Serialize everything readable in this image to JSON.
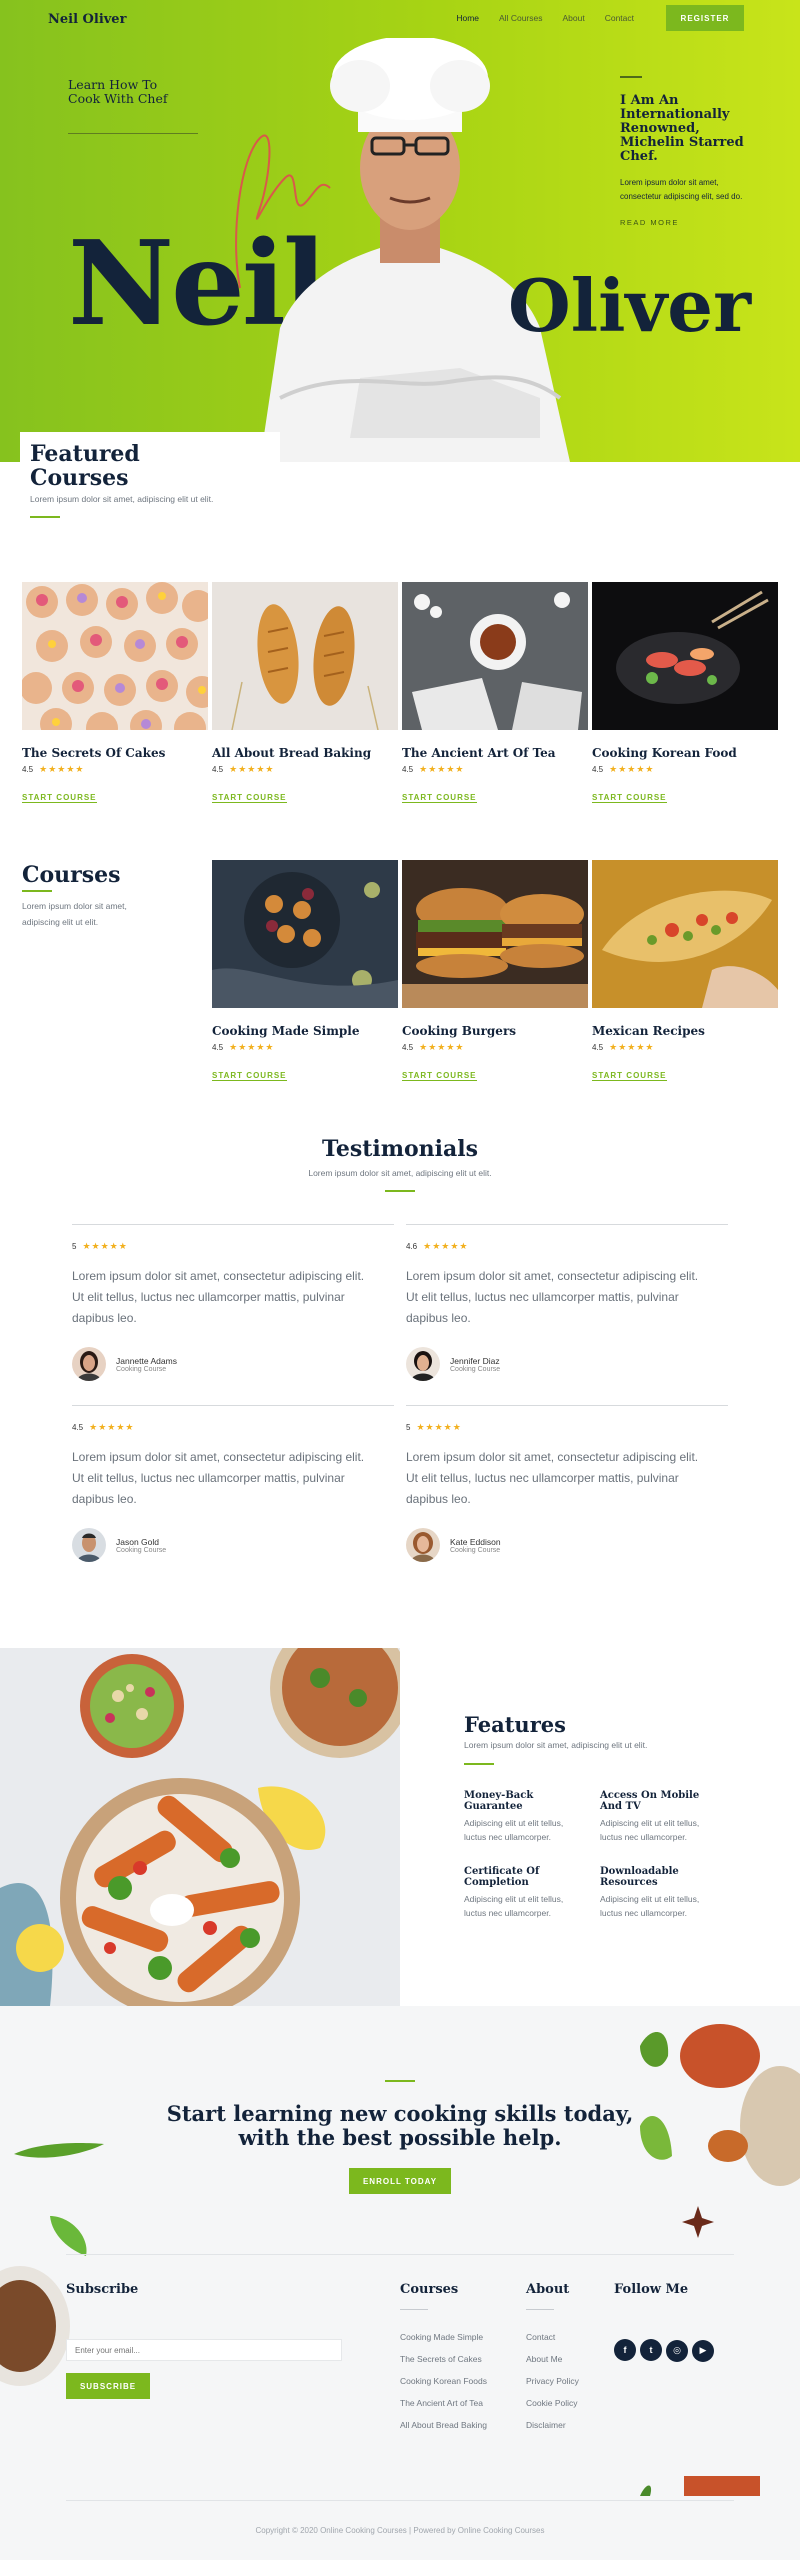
{
  "brand": "Neil Oliver",
  "nav": {
    "items": [
      "Home",
      "All Courses",
      "About",
      "Contact"
    ],
    "register": "REGISTER"
  },
  "hero": {
    "tagline": "Learn How To Cook With Chef",
    "first_name": "Neil",
    "last_name": "Oliver",
    "headline": "I Am An Internationally Renowned, Michelin Starred Chef.",
    "text": "Lorem ipsum dolor sit amet, consectetur adipiscing elit, sed do.",
    "read_more": "READ MORE"
  },
  "featured": {
    "title": "Featured Courses",
    "subtitle": "Lorem ipsum dolor sit amet, adipiscing elit ut elit.",
    "cards": [
      {
        "title": "The Secrets Of Cakes",
        "rating": "4.5",
        "cta": "START COURSE"
      },
      {
        "title": "All About Bread Baking",
        "rating": "4.5",
        "cta": "START COURSE"
      },
      {
        "title": "The Ancient Art Of Tea",
        "rating": "4.5",
        "cta": "START COURSE"
      },
      {
        "title": "Cooking Korean Food",
        "rating": "4.5",
        "cta": "START COURSE"
      }
    ]
  },
  "courses": {
    "title": "Courses",
    "subtitle": "Lorem ipsum dolor sit amet, adipiscing elit ut elit.",
    "cards": [
      {
        "title": "Cooking Made Simple",
        "rating": "4.5",
        "cta": "START COURSE"
      },
      {
        "title": "Cooking Burgers",
        "rating": "4.5",
        "cta": "START COURSE"
      },
      {
        "title": "Mexican Recipes",
        "rating": "4.5",
        "cta": "START COURSE"
      }
    ]
  },
  "testimonials": {
    "title": "Testimonials",
    "subtitle": "Lorem ipsum dolor sit amet, adipiscing elit ut elit.",
    "items": [
      {
        "rating": "5",
        "quote": "Lorem ipsum dolor sit amet, consectetur adipiscing elit. Ut elit tellus, luctus nec ullamcorper mattis, pulvinar dapibus leo.",
        "name": "Jannette Adams",
        "role": "Cooking Course"
      },
      {
        "rating": "4.6",
        "quote": "Lorem ipsum dolor sit amet, consectetur adipiscing elit. Ut elit tellus, luctus nec ullamcorper mattis, pulvinar dapibus leo.",
        "name": "Jennifer Diaz",
        "role": "Cooking Course"
      },
      {
        "rating": "4.5",
        "quote": "Lorem ipsum dolor sit amet, consectetur adipiscing elit. Ut elit tellus, luctus nec ullamcorper mattis, pulvinar dapibus leo.",
        "name": "Jason Gold",
        "role": "Cooking Course"
      },
      {
        "rating": "5",
        "quote": "Lorem ipsum dolor sit amet, consectetur adipiscing elit. Ut elit tellus, luctus nec ullamcorper mattis, pulvinar dapibus leo.",
        "name": "Kate Eddison",
        "role": "Cooking Course"
      }
    ]
  },
  "features": {
    "title": "Features",
    "subtitle": "Lorem ipsum dolor sit amet, adipiscing elit ut elit.",
    "items": [
      {
        "title": "Money-Back Guarantee",
        "text": "Adipiscing elit ut elit tellus, luctus nec ullamcorper."
      },
      {
        "title": "Access On Mobile And TV",
        "text": "Adipiscing elit ut elit tellus, luctus nec ullamcorper."
      },
      {
        "title": "Certificate Of Completion",
        "text": "Adipiscing elit ut elit tellus, luctus nec ullamcorper."
      },
      {
        "title": "Downloadable Resources",
        "text": "Adipiscing elit ut elit tellus, luctus nec ullamcorper."
      }
    ]
  },
  "cta": {
    "headline": "Start learning new cooking skills today, with the best possible help.",
    "button": "ENROLL TODAY"
  },
  "footer": {
    "subscribe_title": "Subscribe",
    "email_placeholder": "Enter your email...",
    "subscribe_button": "SUBSCRIBE",
    "courses_title": "Courses",
    "courses_links": [
      "Cooking Made Simple",
      "The Secrets of Cakes",
      "Cooking Korean Foods",
      "The Ancient Art of Tea",
      "All About Bread Baking"
    ],
    "about_title": "About",
    "about_links": [
      "Contact",
      "About Me",
      "Privacy Policy",
      "Cookie Policy",
      "Disclaimer"
    ],
    "follow_title": "Follow Me",
    "social": [
      "facebook-icon",
      "twitter-icon",
      "instagram-icon",
      "youtube-icon"
    ],
    "copyright": "Copyright © 2020 Online Cooking Courses | Powered by Online Cooking Courses"
  },
  "colors": {
    "accent": "#7cb81e",
    "navy": "#13233a",
    "star": "#f2b01e"
  }
}
